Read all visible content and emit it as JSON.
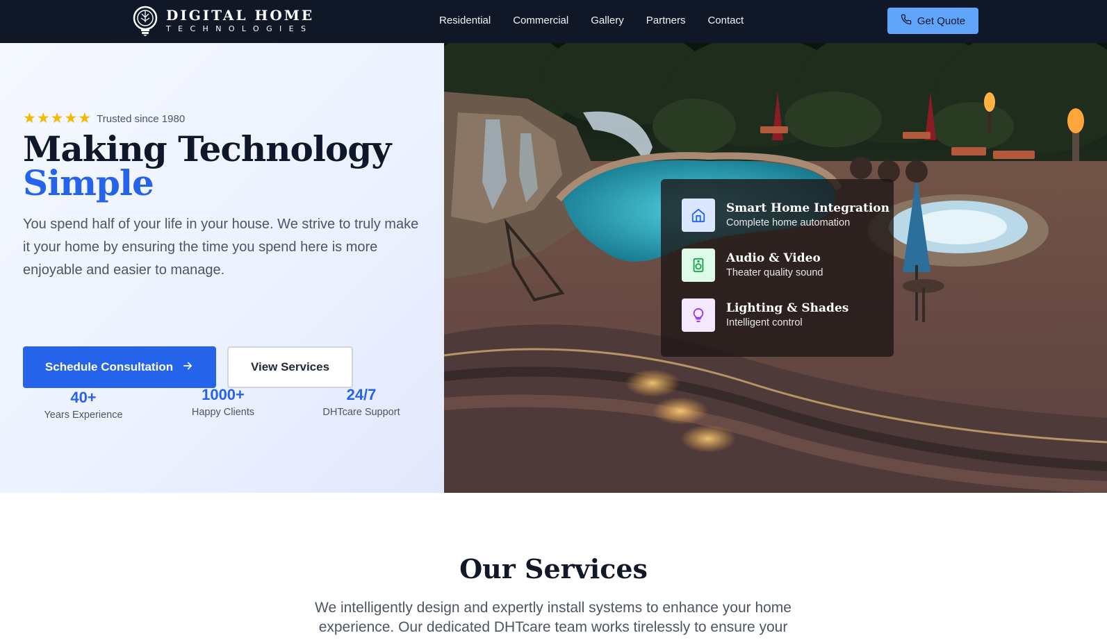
{
  "header": {
    "logo": {
      "line1": "DIGITAL HOME",
      "line2": "TECHNOLOGIES",
      "icon": "lightbulb-logo-icon"
    },
    "nav": [
      "Residential",
      "Commercial",
      "Gallery",
      "Partners",
      "Contact"
    ],
    "quote_button": {
      "label": "Get Quote",
      "icon": "phone-icon"
    }
  },
  "hero": {
    "rating": {
      "stars": 5,
      "text": "Trusted since 1980"
    },
    "headline_line1": "Making Technology",
    "headline_line2": "Simple",
    "lede": "You spend half of your life in your house. We strive to truly make it your home by ensuring the time you spend here is more enjoyable and easier to manage.",
    "primary_button": {
      "label": "Schedule Consultation",
      "icon": "arrow-right-icon"
    },
    "secondary_button": {
      "label": "View Services"
    },
    "stats": [
      {
        "value": "40+",
        "label": "Years Experience"
      },
      {
        "value": "1000+",
        "label": "Happy Clients"
      },
      {
        "value": "24/7",
        "label": "DHTcare Support"
      }
    ]
  },
  "features": [
    {
      "title": "Smart Home Integration",
      "subtitle": "Complete home automation",
      "icon": "home-icon",
      "color": "#2563eb",
      "bg": "#dbe7ff"
    },
    {
      "title": "Audio & Video",
      "subtitle": "Theater quality sound",
      "icon": "speaker-icon",
      "color": "#16a34a",
      "bg": "#dcfce7"
    },
    {
      "title": "Lighting & Shades",
      "subtitle": "Intelligent control",
      "icon": "lightbulb-icon",
      "color": "#9333ea",
      "bg": "#f3e8ff"
    }
  ],
  "services": {
    "title": "Our Services",
    "lede": "We intelligently design and expertly install systems to enhance your home experience. Our dedicated DHTcare team works tirelessly to ensure your"
  },
  "colors": {
    "nav_bg": "#101828",
    "accent": "#2563eb",
    "quote_bg": "#60a5fa",
    "star": "#f5b800"
  }
}
